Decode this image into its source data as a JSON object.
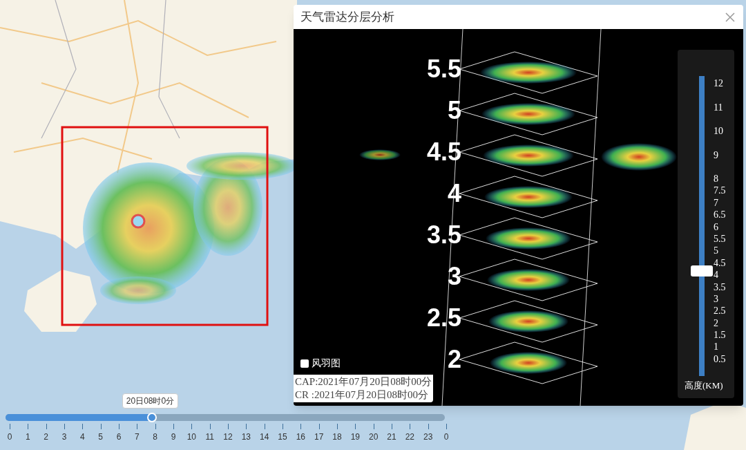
{
  "dialog": {
    "title": "天气雷达分层分析",
    "layers": [
      "5.5",
      "5",
      "4.5",
      "4",
      "3.5",
      "3",
      "2.5",
      "2"
    ],
    "wind_barb": {
      "label": "风羽图",
      "checked": false
    },
    "timestamps": [
      "CAP:2021年07月20日08时00分",
      "CR :2021年07月20日08时00分"
    ],
    "height_slider": {
      "labels": [
        "12",
        "11",
        "10",
        "9",
        "8",
        "7.5",
        "7",
        "6.5",
        "6",
        "5.5",
        "5",
        "4.5",
        "4",
        "3.5",
        "3",
        "2.5",
        "2",
        "1.5",
        "1",
        "0.5"
      ],
      "level": 0.35,
      "unit_label": "高度(KM)"
    }
  },
  "timeline": {
    "tooltip": "20日08时0分",
    "level": 0.333,
    "ticks": [
      "0",
      "1",
      "2",
      "3",
      "4",
      "5",
      "6",
      "7",
      "8",
      "9",
      "10",
      "11",
      "12",
      "13",
      "14",
      "15",
      "16",
      "17",
      "18",
      "19",
      "20",
      "21",
      "22",
      "23",
      "0"
    ]
  }
}
